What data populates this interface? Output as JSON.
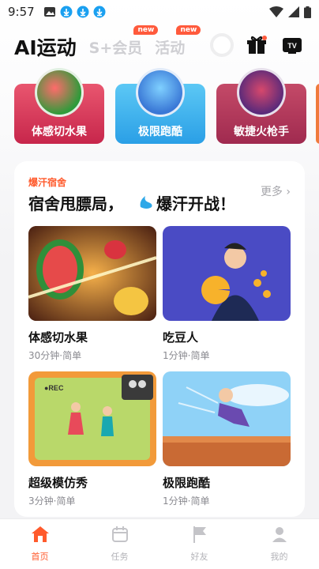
{
  "status": {
    "time": "9:57"
  },
  "header": {
    "tabs": [
      {
        "label": "AI运动",
        "active": true
      },
      {
        "label": "S+会员",
        "badge": "new"
      },
      {
        "label": "活动",
        "badge": "new"
      }
    ]
  },
  "carousel": [
    {
      "label": "体感切水果",
      "icon": "watermelon"
    },
    {
      "label": "极限跑酷",
      "icon": "runner"
    },
    {
      "label": "敏捷火枪手",
      "icon": "robot"
    }
  ],
  "section": {
    "tag": "爆汗宿舍",
    "title_part1": "宿舍甩膘局，",
    "title_part2": "爆汗开战！",
    "more": "更多 ›"
  },
  "games": [
    {
      "name": "体感切水果",
      "meta": "30分钟·简单"
    },
    {
      "name": "吃豆人",
      "meta": "1分钟·简单"
    },
    {
      "name": "超级模仿秀",
      "meta": "3分钟·简单"
    },
    {
      "name": "极限跑酷",
      "meta": "1分钟·简单"
    }
  ],
  "nav": [
    {
      "label": "首页",
      "icon": "home-icon",
      "active": true
    },
    {
      "label": "任务",
      "icon": "calendar-icon"
    },
    {
      "label": "好友",
      "icon": "flag-icon"
    },
    {
      "label": "我的",
      "icon": "user-icon"
    }
  ],
  "colors": {
    "accent": "#ff5a2c",
    "badge": "#ff5a3c"
  }
}
